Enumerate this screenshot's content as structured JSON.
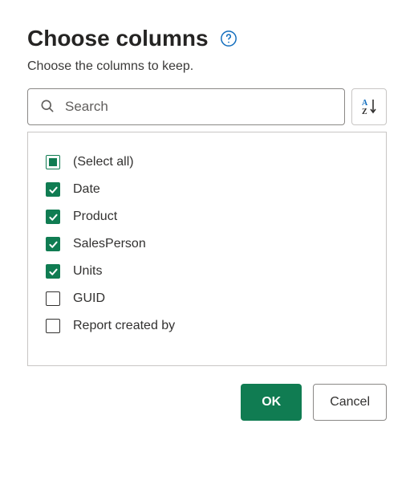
{
  "header": {
    "title": "Choose columns",
    "subtitle": "Choose the columns to keep."
  },
  "search": {
    "placeholder": "Search",
    "value": ""
  },
  "columns": {
    "select_all_label": "(Select all)",
    "select_all_state": "indeterminate",
    "items": [
      {
        "label": "Date",
        "checked": true
      },
      {
        "label": "Product",
        "checked": true
      },
      {
        "label": "SalesPerson",
        "checked": true
      },
      {
        "label": "Units",
        "checked": true
      },
      {
        "label": "GUID",
        "checked": false
      },
      {
        "label": "Report created by",
        "checked": false
      }
    ]
  },
  "footer": {
    "ok": "OK",
    "cancel": "Cancel"
  },
  "colors": {
    "accent": "#107c52",
    "link": "#0f6cbd"
  }
}
